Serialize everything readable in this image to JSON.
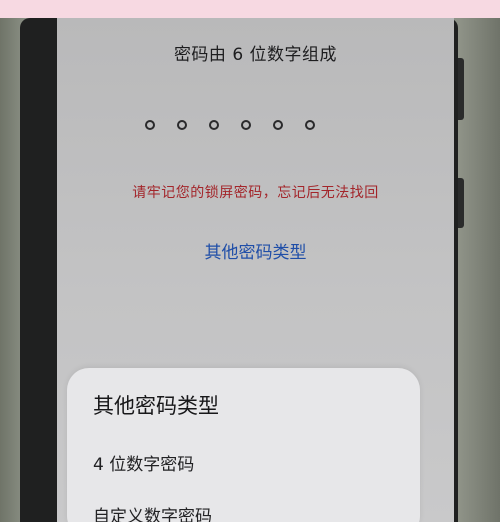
{
  "lock_screen": {
    "title": "密码由 6 位数字组成",
    "dot_count": 6,
    "warning": "请牢记您的锁屏密码，忘记后无法找回",
    "other_types_link": "其他密码类型"
  },
  "sheet": {
    "title": "其他密码类型",
    "options": [
      {
        "label": "4 位数字密码"
      },
      {
        "label": "自定义数字密码"
      }
    ]
  },
  "colors": {
    "warning": "#a3252a",
    "link": "#1f4ea8",
    "background": "#f7d9e2"
  }
}
